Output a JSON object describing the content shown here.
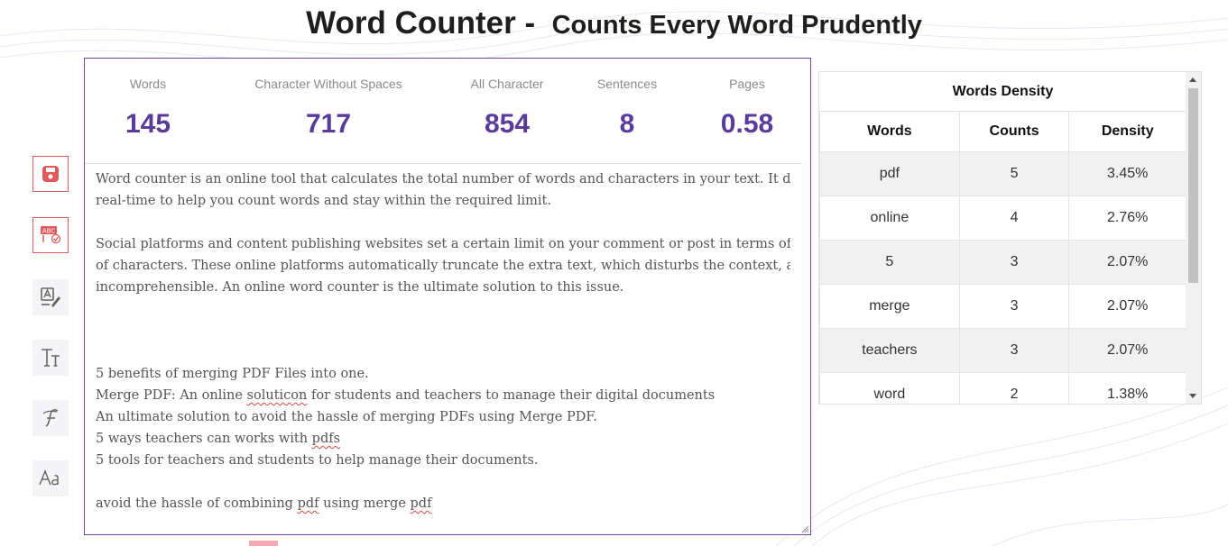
{
  "header": {
    "title": "Word Counter -",
    "subtitle": "Counts Every Word Prudently"
  },
  "toolbar": {
    "items": [
      {
        "icon": "save-icon"
      },
      {
        "icon": "spell-check-icon"
      },
      {
        "icon": "find-replace-icon"
      },
      {
        "icon": "text-size-icon"
      },
      {
        "icon": "font-style-icon"
      },
      {
        "icon": "font-case-icon"
      }
    ]
  },
  "stats": {
    "words": {
      "label": "Words",
      "value": "145"
    },
    "chars_no_spaces": {
      "label": "Character Without Spaces",
      "value": "717"
    },
    "all_chars": {
      "label": "All Character",
      "value": "854"
    },
    "sentences": {
      "label": "Sentences",
      "value": "8"
    },
    "pages": {
      "label": "Pages",
      "value": "0.58"
    }
  },
  "editor": {
    "p1_l1": "Word counter is an online tool that calculates the total number of words and characters in your text. It does that in",
    "p1_l2": "real-time to help you count words and stay within the required limit.",
    "p2_l1": "Social platforms and content publishing websites set a certain limit on your comment or post in terms of the number",
    "p2_l2": "of characters. These online platforms automatically truncate the extra text, which disturbs the context, and makes it",
    "p2_l3": "incomprehensible. An online word counter is the ultimate solution to this issue.",
    "l5": "5 benefits of merging PDF Files into one.",
    "l6_a": "Merge PDF: An online ",
    "l6_b": "soluticon",
    "l6_c": " for students and teachers to manage their digital documents",
    "l7": "An ultimate solution to avoid the hassle of merging PDFs using Merge PDF.",
    "l8_a": "5 ways teachers can works with ",
    "l8_b": "pdfs",
    "l9": "5 tools for teachers and students to help manage their documents.",
    "l10_a": "avoid the hassle of combining ",
    "l10_b": "pdf",
    "l10_c": " using merge ",
    "l10_d": "pdf"
  },
  "density": {
    "title": "Words Density",
    "headers": [
      "Words",
      "Counts",
      "Density"
    ],
    "rows": [
      {
        "word": "pdf",
        "count": "5",
        "density": "3.45%"
      },
      {
        "word": "online",
        "count": "4",
        "density": "2.76%"
      },
      {
        "word": "5",
        "count": "3",
        "density": "2.07%"
      },
      {
        "word": "merge",
        "count": "3",
        "density": "2.07%"
      },
      {
        "word": "teachers",
        "count": "3",
        "density": "2.07%"
      },
      {
        "word": "word",
        "count": "2",
        "density": "1.38%"
      }
    ]
  },
  "colors": {
    "accent": "#5b3b9a",
    "tool_red": "#e05a5a"
  }
}
